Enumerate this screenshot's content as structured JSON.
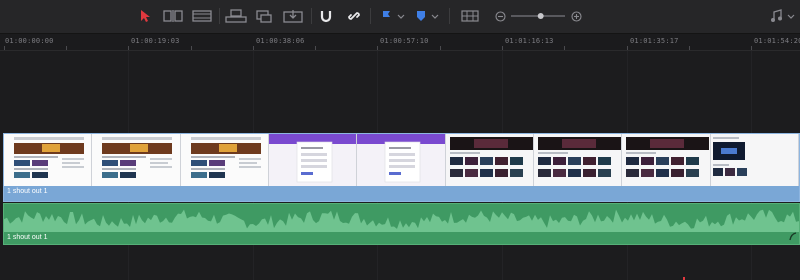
{
  "toolbar": {
    "icons": [
      "selection-arrow-icon",
      "trim-edit-icon",
      "dynamic-trim-icon",
      "overwrite-clip-icon",
      "replace-clip-icon",
      "place-on-top-icon",
      "snapping-magnet-icon",
      "linked-selection-icon",
      "flag-icon",
      "marker-icon",
      "clip-height-icon",
      "zoom-out-icon",
      "zoom-in-icon",
      "audio-note-icon"
    ],
    "zoom_level": 0.55
  },
  "ruler": {
    "timecodes": [
      "01:00:00:00",
      "01:00:19:03",
      "01:00:38:06",
      "01:00:57:10",
      "01:01:16:13",
      "01:01:35:17",
      "01:01:54:20"
    ]
  },
  "video_track": {
    "clip_label": "1 shout out 1"
  },
  "audio_track": {
    "clip_label": "1 shout out 1"
  },
  "colors": {
    "selection_accent": "#e0383e",
    "video_clip": "#7aa7d6",
    "audio_clip": "#3f9a63",
    "flag_marker": "#3f7fe6"
  }
}
